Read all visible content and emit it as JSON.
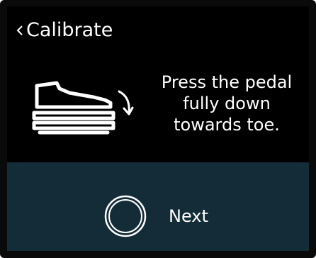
{
  "header": {
    "back_glyph": "<",
    "title": "Calibrate"
  },
  "illustration": {
    "icon": "shoe-on-pedal-rotate-icon"
  },
  "instruction": {
    "text": "Press the pedal\nfully down\ntowards toe."
  },
  "footer": {
    "next_label": "Next",
    "next_icon": "ring-button-icon"
  },
  "colors": {
    "top_background": "#000000",
    "bottom_background": "#142c38",
    "text": "#ffffff",
    "frame": "#0a0a0a"
  }
}
